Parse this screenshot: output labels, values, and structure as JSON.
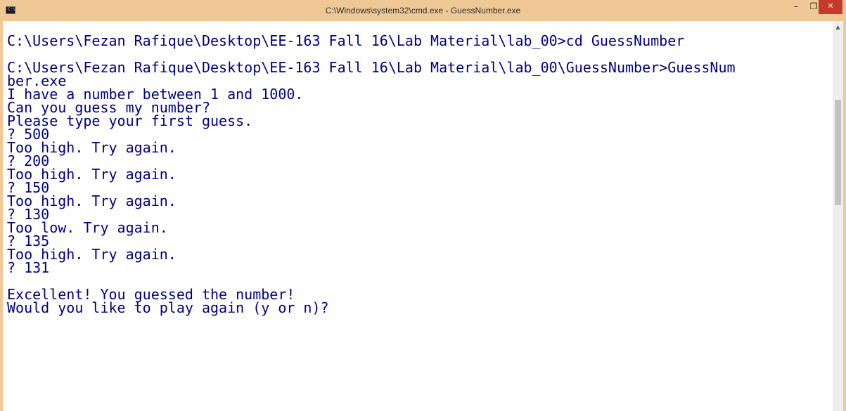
{
  "window": {
    "title": "C:\\Windows\\system32\\cmd.exe - GuessNumber.exe",
    "icon": "cmd-icon",
    "icon_glyph": "C:\\",
    "minimize_glyph": "–",
    "maximize_glyph": "❐",
    "close_glyph": "✕"
  },
  "console": {
    "lines": [
      "",
      "C:\\Users\\Fezan Rafique\\Desktop\\EE-163 Fall 16\\Lab Material\\lab_00>cd GuessNumber",
      "",
      "C:\\Users\\Fezan Rafique\\Desktop\\EE-163 Fall 16\\Lab Material\\lab_00\\GuessNumber>GuessNum",
      "ber.exe",
      "I have a number between 1 and 1000.",
      "Can you guess my number?",
      "Please type your first guess.",
      "? 500",
      "Too high. Try again.",
      "? 200",
      "Too high. Try again.",
      "? 150",
      "Too high. Try again.",
      "? 130",
      "Too low. Try again.",
      "? 135",
      "Too high. Try again.",
      "? 131",
      "",
      "Excellent! You guessed the number!",
      "Would you like to play again (y or n)?"
    ],
    "text_color": "#000080",
    "background_color": "#ffffff"
  },
  "scrollbar": {
    "up_arrow_icon": "chevron-up-icon",
    "up_arrow_glyph": "▲"
  },
  "colors": {
    "titlebar": "#f0c896",
    "close_button": "#c7392b"
  }
}
